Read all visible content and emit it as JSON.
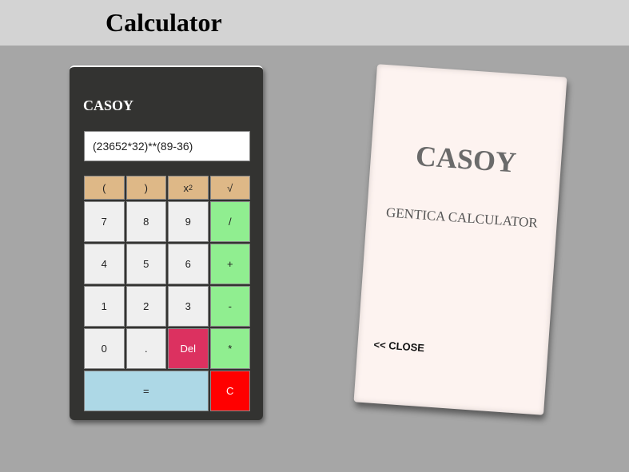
{
  "header": {
    "title": "Calculator"
  },
  "calculator": {
    "brand": "CASOY",
    "display_value": "(23652*32)**(89-36)",
    "top_row": [
      "(",
      ")",
      "x",
      "√"
    ],
    "superscript": "2",
    "rows": [
      [
        "7",
        "8",
        "9",
        "/"
      ],
      [
        "4",
        "5",
        "6",
        "+"
      ],
      [
        "1",
        "2",
        "3",
        "-"
      ],
      [
        "0",
        ".",
        "Del",
        "*"
      ]
    ],
    "equals_label": "=",
    "clear_label": "C"
  },
  "info_card": {
    "title": "CASOY",
    "subtitle": "GENTICA CALCULATOR",
    "close_label": "<< CLOSE"
  }
}
